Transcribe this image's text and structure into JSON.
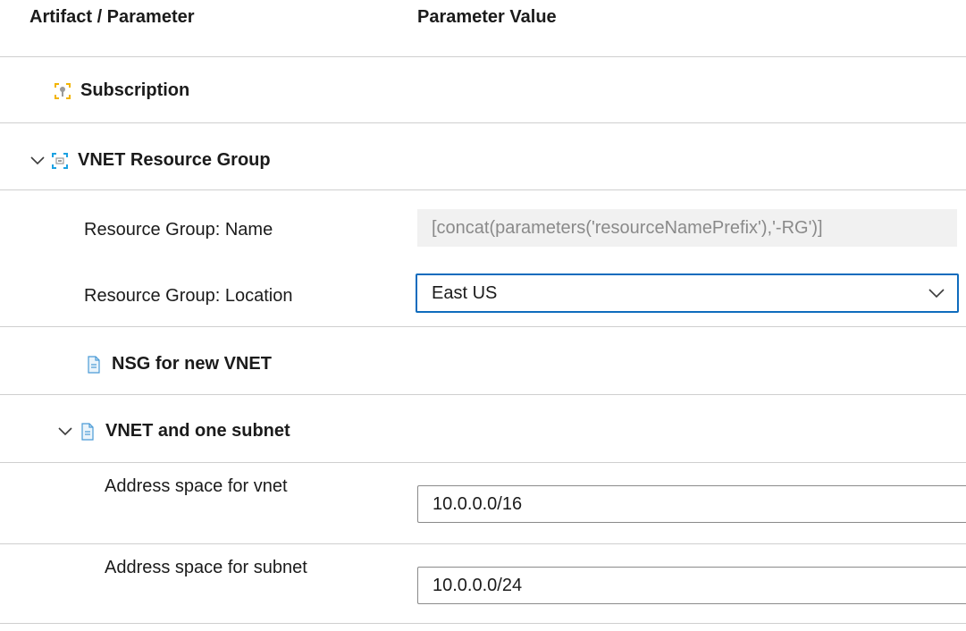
{
  "header": {
    "col_artifact": "Artifact / Parameter",
    "col_value": "Parameter Value"
  },
  "subscription": {
    "label": "Subscription",
    "icon": "key-icon"
  },
  "vnet_rg": {
    "label": "VNET Resource Group",
    "icon": "resource-group-icon",
    "expanded": true,
    "params": {
      "name_label": "Resource Group: Name",
      "name_value": "[concat(parameters('resourceNamePrefix'),'-RG')]",
      "location_label": "Resource Group: Location",
      "location_value": "East US"
    }
  },
  "nsg": {
    "label": "NSG for new VNET",
    "icon": "document-icon"
  },
  "vnet_subnet": {
    "label": "VNET and one subnet",
    "icon": "document-icon",
    "expanded": true,
    "params": {
      "vnet_label": "Address space for vnet",
      "vnet_value": "10.0.0.0/16",
      "subnet_label": "Address space for subnet",
      "subnet_value": "10.0.0.0/24"
    }
  },
  "colors": {
    "accent": "#0f6cbd",
    "divider": "#cfcfcf",
    "readonly_bg": "#f1f1f1"
  }
}
